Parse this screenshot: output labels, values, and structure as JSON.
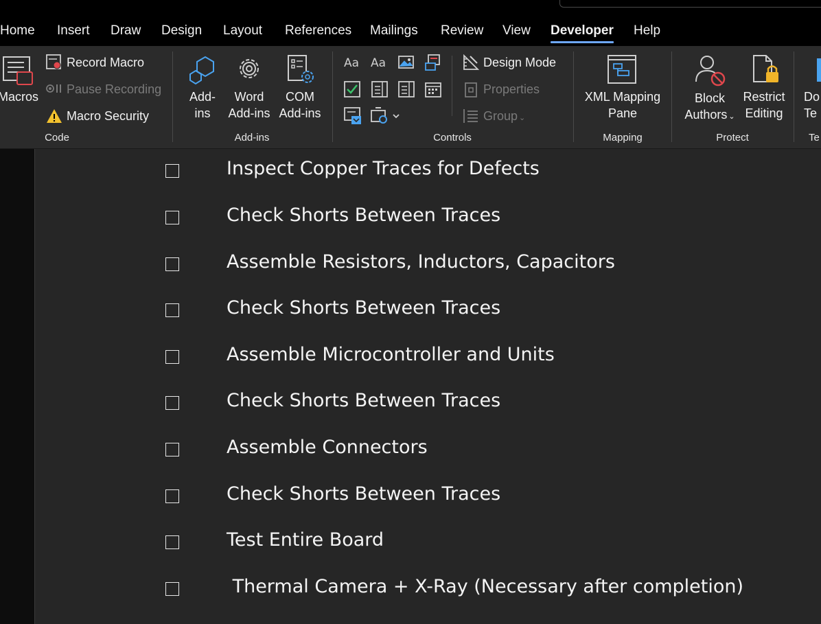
{
  "tabs": [
    "Home",
    "Insert",
    "Draw",
    "Design",
    "Layout",
    "References",
    "Mailings",
    "Review",
    "View",
    "Developer",
    "Help"
  ],
  "active_tab": "Developer",
  "ribbon": {
    "code": {
      "macros": "Macros",
      "record_macro": "Record Macro",
      "pause_recording": "Pause Recording",
      "macro_security": "Macro Security",
      "label": "Code"
    },
    "addins": {
      "addins_line1": "Add-",
      "addins_line2": "ins",
      "word_line1": "Word",
      "word_line2": "Add-ins",
      "com_line1": "COM",
      "com_line2": "Add-ins",
      "label": "Add-ins"
    },
    "controls": {
      "design_mode": "Design Mode",
      "properties": "Properties",
      "group": "Group",
      "label": "Controls"
    },
    "mapping": {
      "xml_line1": "XML Mapping",
      "xml_line2": "Pane",
      "label": "Mapping"
    },
    "protect": {
      "block_line1": "Block",
      "block_line2": "Authors",
      "restrict_line1": "Restrict",
      "restrict_line2": "Editing",
      "label": "Protect"
    },
    "templates": {
      "line1": "Do",
      "line2": "Te",
      "label": "Te"
    }
  },
  "checklist": [
    "Inspect Copper Traces for Defects",
    "Check Shorts Between Traces",
    "Assemble Resistors, Inductors, Capacitors",
    "Check Shorts Between Traces",
    "Assemble Microcontroller and Units",
    "Check Shorts Between Traces",
    "Assemble Connectors",
    "Check Shorts Between Traces",
    "Test Entire Board",
    " Thermal Camera + X-Ray (Necessary after completion)"
  ],
  "colors": {
    "accent": "#6ea8fe",
    "ribbon_bg": "#2b2b2b",
    "doc_bg": "#262626",
    "warning": "#f2c12e",
    "blocked": "#e0474c",
    "lock": "#f0b429",
    "icon_blue": "#4aa3f0"
  }
}
